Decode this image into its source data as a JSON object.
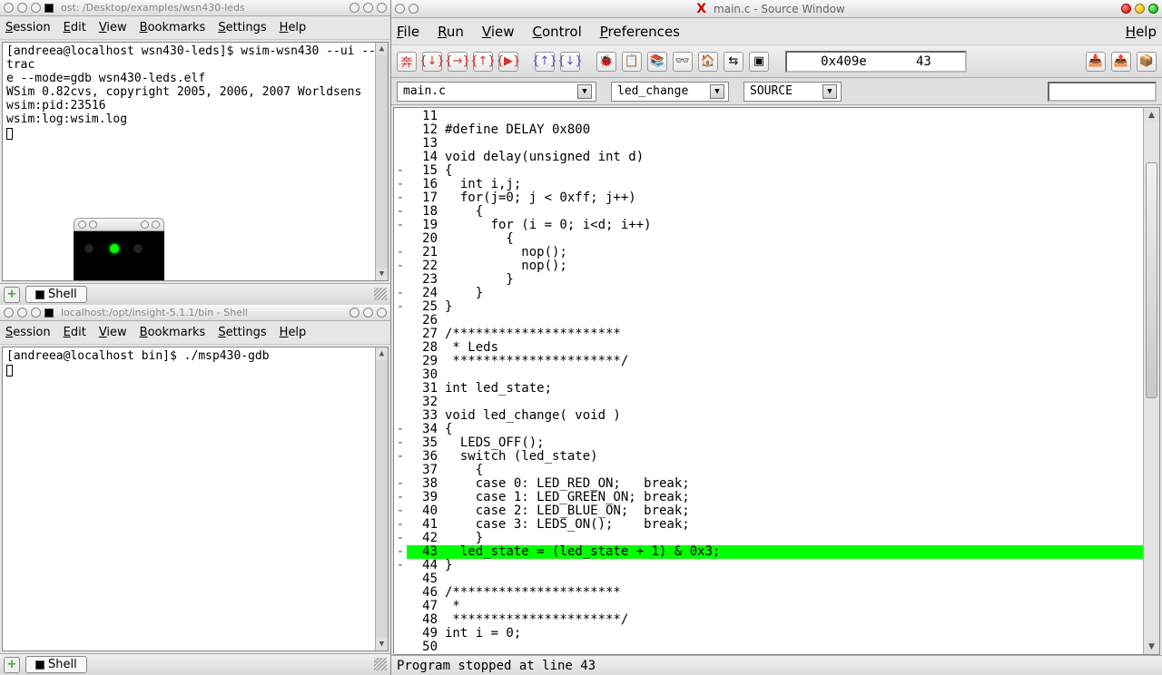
{
  "panel1": {
    "titlebar": "ost: /Desktop/examples/wsn430-leds",
    "menu": [
      "Session",
      "Edit",
      "View",
      "Bookmarks",
      "Settings",
      "Help"
    ],
    "term_lines": [
      "[andreea@localhost wsn430-leds]$ wsim-wsn430 --ui --trace --mode=gdb wsn430-leds.elf",
      "WSim 0.82cvs, copyright 2005, 2006, 2007 Worldsens",
      "wsim:pid:23516",
      "wsim:log:wsim.log"
    ],
    "tab": "Shell"
  },
  "panel2": {
    "titlebar": "localhost:/opt/insight-5.1.1/bin - Shell",
    "menu": [
      "Session",
      "Edit",
      "View",
      "Bookmarks",
      "Settings",
      "Help"
    ],
    "term_lines": [
      "[andreea@localhost bin]$ ./msp430-gdb"
    ],
    "tab": "Shell"
  },
  "source_win": {
    "title": "main.c - Source Window",
    "menu": [
      "File",
      "Run",
      "View",
      "Control",
      "Preferences"
    ],
    "menu_help": "Help",
    "addr": "0x409e",
    "line_no": "43",
    "dropdown_file": "main.c",
    "dropdown_func": "led_change",
    "dropdown_mode": "SOURCE",
    "status": "Program stopped at line 43",
    "code": [
      {
        "n": 11,
        "g": "",
        "t": ""
      },
      {
        "n": 12,
        "g": "",
        "t": "#define DELAY 0x800"
      },
      {
        "n": 13,
        "g": "",
        "t": ""
      },
      {
        "n": 14,
        "g": "",
        "t": "void delay(unsigned int d)"
      },
      {
        "n": 15,
        "g": "-",
        "t": "{"
      },
      {
        "n": 16,
        "g": "-",
        "t": "  int i,j;"
      },
      {
        "n": 17,
        "g": "-",
        "t": "  for(j=0; j < 0xff; j++)"
      },
      {
        "n": 18,
        "g": "-",
        "t": "    {"
      },
      {
        "n": 19,
        "g": "-",
        "t": "      for (i = 0; i<d; i++)"
      },
      {
        "n": 20,
        "g": "",
        "t": "        {"
      },
      {
        "n": 21,
        "g": "-",
        "t": "          nop();"
      },
      {
        "n": 22,
        "g": "-",
        "t": "          nop();"
      },
      {
        "n": 23,
        "g": "",
        "t": "        }"
      },
      {
        "n": 24,
        "g": "-",
        "t": "    }"
      },
      {
        "n": 25,
        "g": "-",
        "t": "}"
      },
      {
        "n": 26,
        "g": "",
        "t": ""
      },
      {
        "n": 27,
        "g": "",
        "t": "/**********************"
      },
      {
        "n": 28,
        "g": "",
        "t": " * Leds"
      },
      {
        "n": 29,
        "g": "",
        "t": " **********************/"
      },
      {
        "n": 30,
        "g": "",
        "t": ""
      },
      {
        "n": 31,
        "g": "",
        "t": "int led_state;"
      },
      {
        "n": 32,
        "g": "",
        "t": ""
      },
      {
        "n": 33,
        "g": "",
        "t": "void led_change( void )"
      },
      {
        "n": 34,
        "g": "-",
        "t": "{"
      },
      {
        "n": 35,
        "g": "-",
        "t": "  LEDS_OFF();"
      },
      {
        "n": 36,
        "g": "-",
        "t": "  switch (led_state)"
      },
      {
        "n": 37,
        "g": "",
        "t": "    {"
      },
      {
        "n": 38,
        "g": "-",
        "t": "    case 0: LED_RED_ON;   break;"
      },
      {
        "n": 39,
        "g": "-",
        "t": "    case 1: LED_GREEN_ON; break;"
      },
      {
        "n": 40,
        "g": "-",
        "t": "    case 2: LED_BLUE_ON;  break;"
      },
      {
        "n": 41,
        "g": "-",
        "t": "    case 3: LEDS_ON();    break;"
      },
      {
        "n": 42,
        "g": "-",
        "t": "    }"
      },
      {
        "n": 43,
        "g": "-",
        "t": "  led_state = (led_state + 1) & 0x3;          ",
        "hl": true
      },
      {
        "n": 44,
        "g": "-",
        "t": "}"
      },
      {
        "n": 45,
        "g": "",
        "t": ""
      },
      {
        "n": 46,
        "g": "",
        "t": "/**********************"
      },
      {
        "n": 47,
        "g": "",
        "t": " *"
      },
      {
        "n": 48,
        "g": "",
        "t": " **********************/"
      },
      {
        "n": 49,
        "g": "",
        "t": "int i = 0;"
      },
      {
        "n": 50,
        "g": "",
        "t": ""
      }
    ]
  },
  "toolbar_icons": [
    "run-icon",
    "step-icon",
    "next-icon",
    "finish-icon",
    "continue-icon",
    "up-icon",
    "down-icon",
    "breakpoint-icon",
    "watch-icon",
    "stack-icon",
    "memory-icon",
    "home-icon",
    "signals-icon",
    "console-icon"
  ],
  "right_icons": [
    "regs-down-icon",
    "regs-up-icon",
    "regs-same-icon"
  ]
}
